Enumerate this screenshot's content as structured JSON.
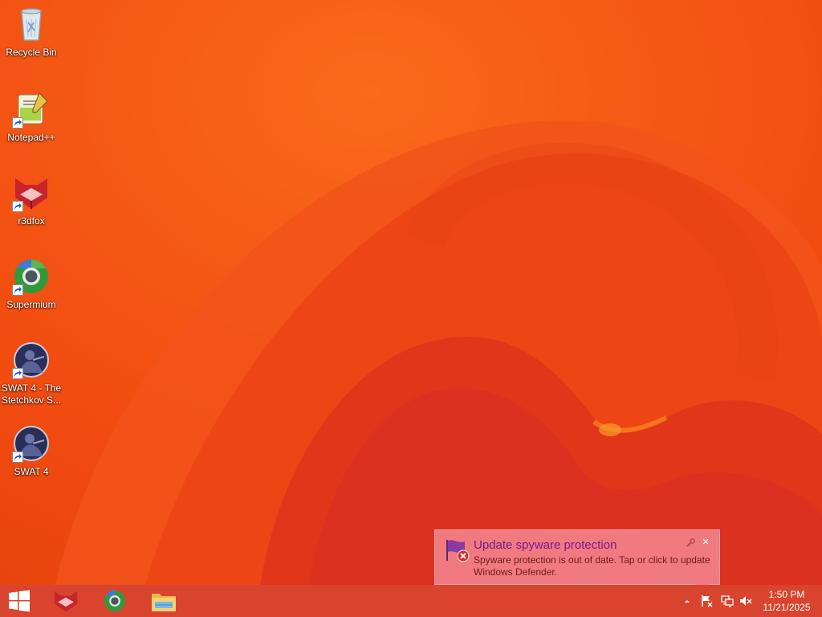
{
  "desktop": {
    "icons": [
      {
        "label": "Recycle Bin",
        "icon": "recycle-bin-icon"
      },
      {
        "label": "Notepad++",
        "icon": "notepadpp-icon"
      },
      {
        "label": "r3dfox",
        "icon": "r3dfox-icon"
      },
      {
        "label": "Supermium",
        "icon": "supermium-icon"
      },
      {
        "label": "SWAT 4 - The Stetchkov S...",
        "icon": "swat4-icon"
      },
      {
        "label": "SWAT 4",
        "icon": "swat4-icon"
      }
    ]
  },
  "notification": {
    "title": "Update spyware protection",
    "body": "Spyware protection is out of date. Tap or click to update Windows Defender.",
    "icon": "windows-defender-flag-icon",
    "close_label": "×"
  },
  "taskbar": {
    "pinned": [
      {
        "icon": "start-windows-icon"
      },
      {
        "icon": "r3dfox-icon"
      },
      {
        "icon": "supermium-icon"
      },
      {
        "icon": "file-explorer-icon"
      }
    ],
    "tray": {
      "icons": [
        "show-hidden-icons-chevron",
        "action-center-flag-icon",
        "network-icon",
        "volume-muted-icon"
      ]
    },
    "clock": {
      "time": "1:50 PM",
      "date": "11/21/2025"
    }
  },
  "colors": {
    "wallpaper_base": "#f04a10",
    "taskbar": "#d8442e",
    "toast_background": "#f07a80",
    "toast_title": "#7a1a8c"
  }
}
